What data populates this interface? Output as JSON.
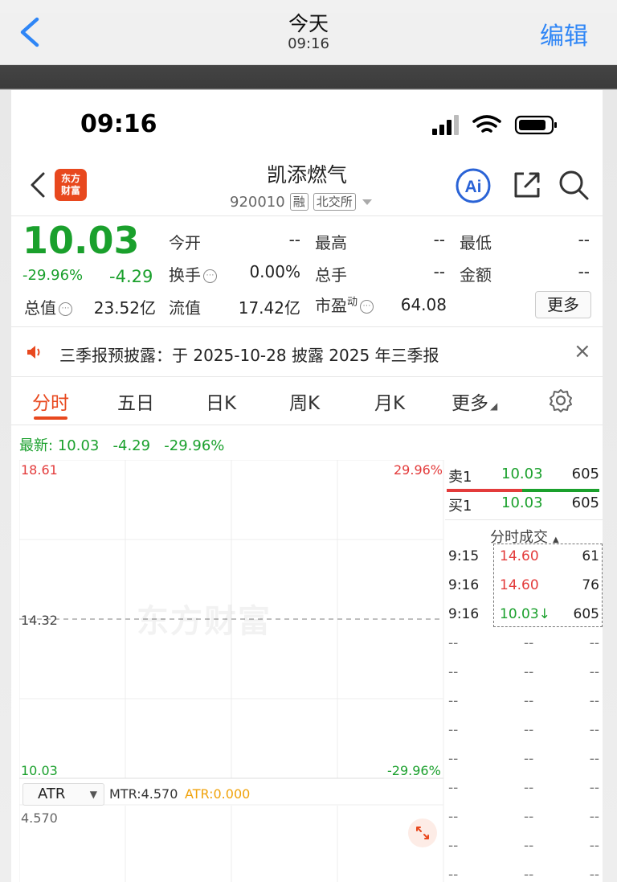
{
  "viewer": {
    "title": "今天",
    "time": "09:16",
    "edit_label": "编辑"
  },
  "status_bar": {
    "time": "09:16"
  },
  "stock": {
    "name": "凯添燃气",
    "code": "920010",
    "tag_margin": "融",
    "tag_exchange": "北交所",
    "price": "10.03",
    "change_pct": "-29.96%",
    "change_abs": "-4.29",
    "logo_text_1": "东方",
    "logo_text_2": "财富"
  },
  "quote": {
    "open_label": "今开",
    "open_value": "--",
    "high_label": "最高",
    "high_value": "--",
    "low_label": "最低",
    "low_value": "--",
    "turnover_label": "换手",
    "turnover_value": "0.00%",
    "volume_label": "总手",
    "volume_value": "--",
    "amount_label": "金额",
    "amount_value": "--",
    "mktcap_label": "总值",
    "mktcap_value": "23.52亿",
    "float_label": "流值",
    "float_value": "17.42亿",
    "pe_label": "市盈",
    "pe_sup": "动",
    "pe_value": "64.08",
    "more_label": "更多"
  },
  "notice": {
    "text": "三季报预披露：于 2025-10-28 披露 2025 年三季报"
  },
  "tabs": [
    {
      "label": "分时",
      "active": true
    },
    {
      "label": "五日"
    },
    {
      "label": "日K"
    },
    {
      "label": "周K"
    },
    {
      "label": "月K"
    },
    {
      "label": "更多"
    }
  ],
  "latest_line": {
    "label": "最新:",
    "price": "10.03",
    "change": "-4.29",
    "pct": "-29.96%"
  },
  "chart": {
    "top_price": "18.61",
    "top_pct": "29.96%",
    "mid_price": "14.32",
    "bottom_price": "10.03",
    "bottom_pct": "-29.96%",
    "watermark": "东方财富",
    "indicator_select": "ATR",
    "mtr_text": "MTR:4.570",
    "atr_text": "ATR:0.000",
    "sub_top": "4.570",
    "colors": {
      "up": "#e33b3b",
      "down": "#1aa02c",
      "accent": "#e8481e"
    }
  },
  "orderbook": {
    "sell1": {
      "label": "卖1",
      "price": "10.03",
      "volume": "605"
    },
    "buy1": {
      "label": "买1",
      "price": "10.03",
      "volume": "605"
    },
    "ticks_header": "分时成交",
    "ticks": [
      {
        "time": "9:15",
        "price": "14.60",
        "volume": "61",
        "dir": "up"
      },
      {
        "time": "9:16",
        "price": "14.60",
        "volume": "76",
        "dir": "up"
      },
      {
        "time": "9:16",
        "price": "10.03↓",
        "volume": "605",
        "dir": "down"
      }
    ],
    "empty_rows": 9,
    "empty": "--"
  }
}
